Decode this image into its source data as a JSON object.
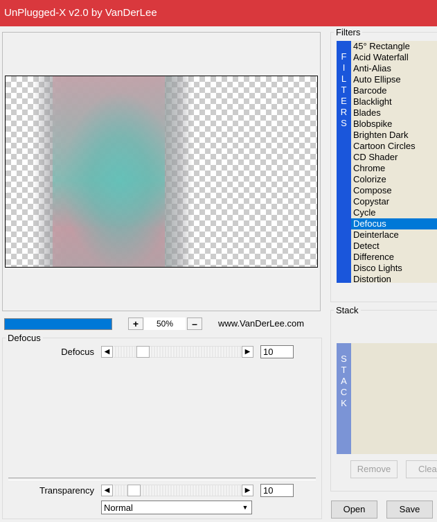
{
  "window": {
    "title": "UnPlugged-X v2.0 by VanDerLee"
  },
  "preview": {
    "progress_percent": 100
  },
  "zoom": {
    "plus_label": "+",
    "minus_label": "–",
    "value": "50%"
  },
  "website": "www.VanDerLee.com",
  "filter_group": {
    "title": "Defocus",
    "params": [
      {
        "label": "Defocus",
        "value": "10",
        "slider_fraction": 0.2
      }
    ]
  },
  "transparency": {
    "label": "Transparency",
    "value": "10",
    "slider_fraction": 0.12
  },
  "blend_mode": {
    "selected": "Normal"
  },
  "filters_panel": {
    "title": "Filters",
    "side_label": [
      "F",
      "I",
      "L",
      "T",
      "E",
      "R",
      "S"
    ],
    "items": [
      "45° Rectangle",
      "Acid Waterfall",
      "Anti-Alias",
      "Auto Ellipse",
      "Barcode",
      "Blacklight",
      "Blades",
      "Blobspike",
      "Brighten Dark",
      "Cartoon Circles",
      "CD Shader",
      "Chrome",
      "Colorize",
      "Compose",
      "Copystar",
      "Cycle",
      "Defocus",
      "Deinterlace",
      "Detect",
      "Difference",
      "Disco Lights",
      "Distortion"
    ],
    "selected": "Defocus"
  },
  "stack_panel": {
    "title": "Stack",
    "side_label": [
      "S",
      "T",
      "A",
      "C",
      "K"
    ],
    "remove_label": "Remove",
    "clear_label": "Clea"
  },
  "footer": {
    "open_label": "Open",
    "save_label": "Save"
  },
  "colors": {
    "title_bar": "#d9383d",
    "accent": "#0078d7",
    "side_bar": "#1a56db",
    "stack_bar": "#7b94d6",
    "list_bg": "#ebe7d7"
  },
  "icons": {
    "left_arrow": "left-arrow-icon",
    "right_arrow": "right-arrow-icon",
    "dropdown": "dropdown-arrow-icon"
  }
}
